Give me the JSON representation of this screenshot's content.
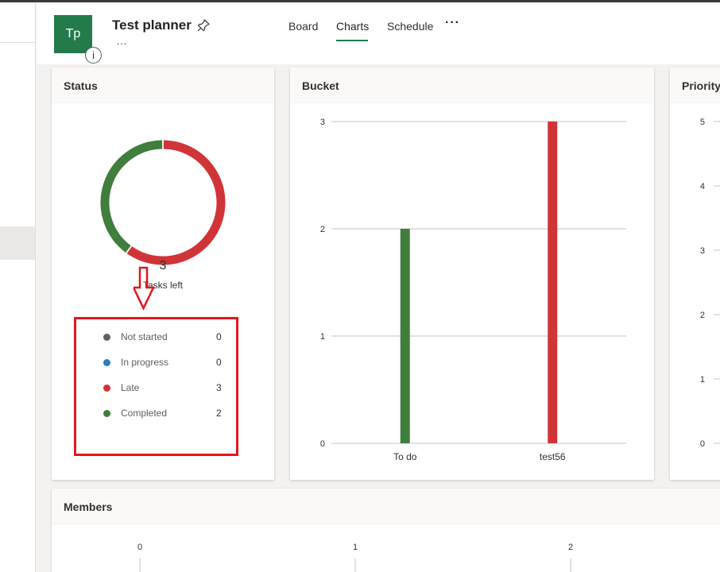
{
  "header": {
    "avatar_initials": "Tp",
    "info_icon": "i",
    "plan_title": "Test planner",
    "title_more": "…",
    "tabs": [
      {
        "label": "Board",
        "active": false
      },
      {
        "label": "Charts",
        "active": true
      },
      {
        "label": "Schedule",
        "active": false
      }
    ],
    "more_label": "···",
    "accent_color": "#237b4b"
  },
  "status_card": {
    "title": "Status",
    "center_value": "3",
    "center_label": "Tasks left",
    "legend": [
      {
        "label": "Not started",
        "count": "0",
        "color": "#616161"
      },
      {
        "label": "In progress",
        "count": "0",
        "color": "#2b7dbd"
      },
      {
        "label": "Late",
        "count": "3",
        "color": "#d13438"
      },
      {
        "label": "Completed",
        "count": "2",
        "color": "#3f7e3c"
      }
    ]
  },
  "bucket_card": {
    "title": "Bucket"
  },
  "priority_card": {
    "title": "Priority"
  },
  "members_card": {
    "title": "Members"
  },
  "chart_data": [
    {
      "type": "pie",
      "title": "Status",
      "categories": [
        "Late",
        "Completed"
      ],
      "values": [
        3,
        2
      ],
      "colors": [
        "#d13438",
        "#3f7e3c"
      ],
      "donut": true
    },
    {
      "type": "bar",
      "title": "Bucket",
      "categories": [
        "To do",
        "test56"
      ],
      "values": [
        2,
        3
      ],
      "colors": [
        "#3f7e3c",
        "#d13438"
      ],
      "ylim": [
        0,
        3
      ],
      "yticks": [
        "0",
        "1",
        "2",
        "3"
      ],
      "grid": true
    },
    {
      "type": "bar",
      "title": "Priority",
      "yticks": [
        "0",
        "1",
        "2",
        "3",
        "4",
        "5"
      ],
      "ylim": [
        0,
        5
      ],
      "grid": true
    },
    {
      "type": "bar",
      "title": "Members",
      "xticks": [
        "0",
        "1",
        "2"
      ],
      "grid": true
    }
  ]
}
